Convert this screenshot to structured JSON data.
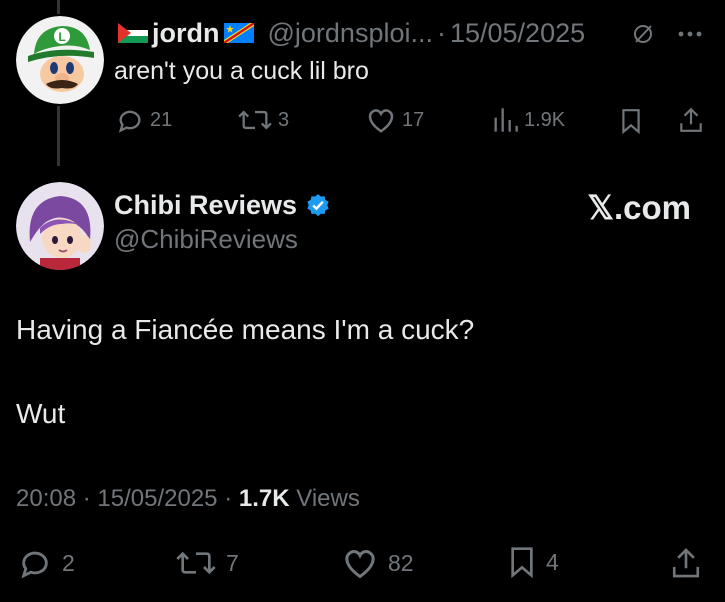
{
  "reply": {
    "name": "jordn",
    "handle": "@jordnsploi...",
    "separator": "·",
    "date": "15/05/2025",
    "text": "aren't you a cuck lil bro",
    "actions": {
      "replies": "21",
      "reposts": "3",
      "likes": "17",
      "views": "1.9K"
    },
    "icons": [
      "grok-icon",
      "more-icon",
      "reply-icon",
      "repost-icon",
      "like-icon",
      "views-icon",
      "bookmark-icon",
      "share-icon"
    ]
  },
  "tweet": {
    "name": "Chibi Reviews",
    "handle": "@ChibiReviews",
    "verified": true,
    "brand": "𝕏.com",
    "lines": [
      "Having a Fiancée means I'm a cuck?",
      "Wut"
    ],
    "time": "20:08",
    "separator": "·",
    "date": "15/05/2025",
    "views_count": "1.7K",
    "views_label": "Views",
    "actions": {
      "replies": "2",
      "reposts": "7",
      "likes": "82",
      "bookmarks": "4"
    }
  },
  "colors": {
    "background": "#000000",
    "text": "#e7e9ea",
    "muted": "#71767b",
    "verified": "#1d9bf0",
    "thread_line": "#333639"
  }
}
